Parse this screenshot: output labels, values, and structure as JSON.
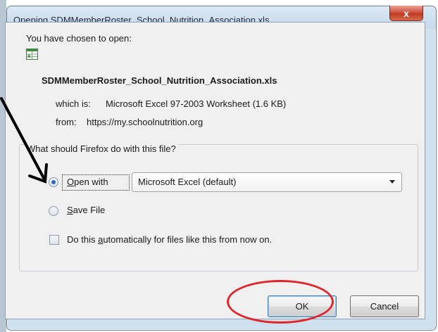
{
  "dialog": {
    "title": "Opening SDMMemberRoster_School_Nutrition_Association.xls",
    "close_glyph": "x",
    "intro": "You have chosen to open:",
    "file_name": "SDMMemberRoster_School_Nutrition_Association.xls",
    "file_icon": "excel-file-icon",
    "which_is_label": "which is:",
    "which_is_value": "Microsoft Excel 97-2003 Worksheet (1.6 KB)",
    "from_label": "from:",
    "from_value": "https://my.schoolnutrition.org",
    "question": "What should Firefox do with this file?",
    "open_with": {
      "prefix": "",
      "accel": "O",
      "rest": "pen with",
      "checked": true
    },
    "open_with_app": "Microsoft Excel (default)",
    "save_file": {
      "accel": "S",
      "rest": "ave File",
      "checked": false
    },
    "auto": {
      "prefix": "Do this ",
      "accel": "a",
      "rest": "utomatically for files like this from now on.",
      "checked": false
    },
    "ok_label": "OK",
    "cancel_label": "Cancel"
  },
  "annotations": {
    "arrow_color": "#000000",
    "ellipse_color": "#e0262d"
  }
}
